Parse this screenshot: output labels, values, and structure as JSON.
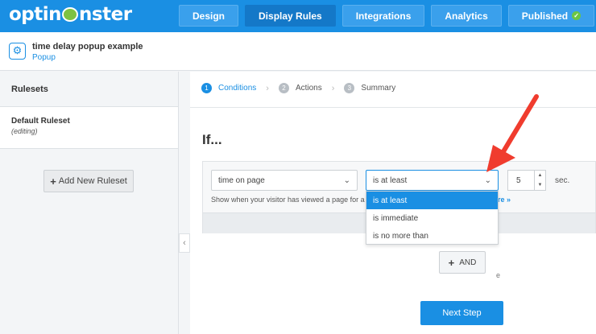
{
  "header": {
    "logo_text": "optinmonster",
    "tabs": [
      {
        "label": "Design"
      },
      {
        "label": "Display Rules"
      },
      {
        "label": "Integrations"
      },
      {
        "label": "Analytics"
      },
      {
        "label": "Published"
      }
    ],
    "active_tab": "Display Rules"
  },
  "campaign": {
    "title": "time delay popup example",
    "type": "Popup"
  },
  "sidebar": {
    "heading": "Rulesets",
    "rulesets": [
      {
        "name": "Default Ruleset",
        "status": "(editing)"
      }
    ],
    "add_button": "Add New Ruleset"
  },
  "steps": [
    {
      "num": "1",
      "label": "Conditions",
      "active": true
    },
    {
      "num": "2",
      "label": "Actions",
      "active": false
    },
    {
      "num": "3",
      "label": "Summary",
      "active": false
    }
  ],
  "rule": {
    "if_label": "If...",
    "condition": "time on page",
    "operator": "is at least",
    "value": "5",
    "unit": "sec.",
    "helper": "Show when your visitor has viewed a page for a sp",
    "more_link": "re »",
    "hidden_tail": "e"
  },
  "operator_options": [
    {
      "label": "is at least",
      "selected": true
    },
    {
      "label": "is immediate",
      "selected": false
    },
    {
      "label": "is no more than",
      "selected": false
    }
  ],
  "and_button": "AND",
  "next_button": "Next Step",
  "colors": {
    "brand_blue": "#1a8fe3",
    "arrow_red": "#f03c2e",
    "published_green": "#6cc644"
  }
}
